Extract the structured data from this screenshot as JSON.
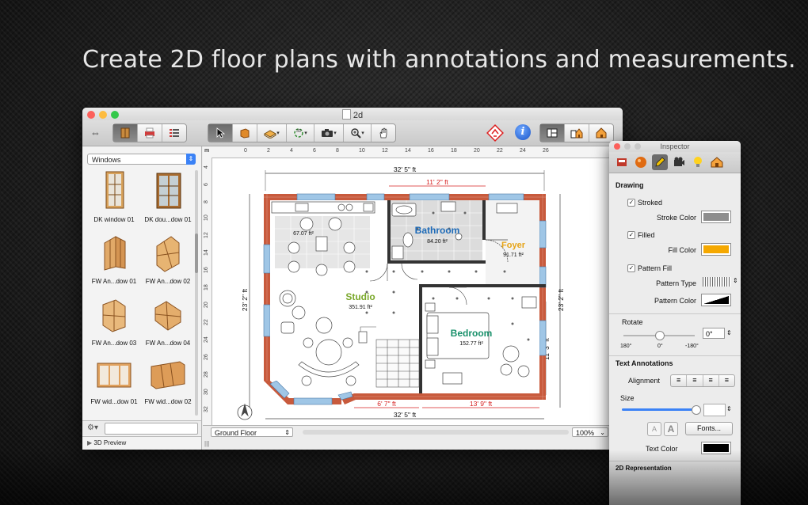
{
  "headline": "Create 2D floor plans with annotations and measurements.",
  "window": {
    "title": "2d",
    "traffic_lights": {
      "close": "#fc605b",
      "minimize": "#fdbc40",
      "zoom": "#34c84a"
    }
  },
  "toolbar": {
    "icons": [
      "resize-arrows-icon",
      "window-icon",
      "printer-icon",
      "list-icon",
      "pointer-icon",
      "wall-icon",
      "floor-icon",
      "rotate-icon",
      "camera-icon",
      "zoom-icon",
      "hand-icon",
      "warning-icon",
      "info-icon",
      "layout-2d-icon",
      "layout-split-icon",
      "layout-3d-icon"
    ]
  },
  "sidebar": {
    "category": "Windows",
    "items": [
      {
        "label": "DK window 01"
      },
      {
        "label": "DK dou...dow 01"
      },
      {
        "label": "FW An...dow 01"
      },
      {
        "label": "FW An...dow 02"
      },
      {
        "label": "FW An...dow 03"
      },
      {
        "label": "FW An...dow 04"
      },
      {
        "label": "FW wid...dow 01"
      },
      {
        "label": "FW wid...dow 02"
      }
    ],
    "preview_label": "3D Preview"
  },
  "ruler": {
    "unit": "m",
    "h_ticks": [
      "0",
      "2",
      "4",
      "6",
      "8",
      "10",
      "12",
      "14",
      "16",
      "18",
      "20",
      "22",
      "24",
      "26"
    ],
    "v_ticks": [
      "4",
      "6",
      "8",
      "10",
      "12",
      "14",
      "16",
      "18",
      "20",
      "22",
      "24",
      "26",
      "28",
      "30",
      "32"
    ]
  },
  "plan": {
    "dimensions": {
      "top_total": "32' 5\" ft",
      "top_bath": "11' 2\" ft",
      "left": "23' 2\" ft",
      "right": "23' 2\" ft",
      "right_bed": "11' 3\" ft",
      "bottom_left": "6' 7\" ft",
      "bottom_right": "13' 9\" ft",
      "bottom_total": "32' 5\" ft"
    },
    "rooms": {
      "kitchen_area": "67.07 ft²",
      "bathroom_name": "Bathroom",
      "bathroom_area": "84.20 ft²",
      "foyer_name": "Foyer",
      "foyer_area": "91.71 ft²",
      "studio_name": "Studio",
      "studio_area": "351.91 ft²",
      "bedroom_name": "Bedroom",
      "bedroom_area": "152.77 ft²"
    },
    "colors": {
      "bathroom": "#1e6bb8",
      "foyer": "#e6a417",
      "studio": "#7aa82b",
      "bedroom": "#18906a",
      "brick": "#c85a3c",
      "window": "#9fc6e6",
      "dim_red": "#d62020"
    }
  },
  "statusbar": {
    "floor": "Ground Floor",
    "zoom": "100%"
  },
  "inspector": {
    "title": "Inspector",
    "drawing_header": "Drawing",
    "stroked_label": "Stroked",
    "stroked": true,
    "stroke_color_label": "Stroke Color",
    "stroke_color": "#8e8e8e",
    "filled_label": "Filled",
    "filled": true,
    "fill_color_label": "Fill Color",
    "fill_color": "#f5a800",
    "pattern_fill_label": "Pattern Fill",
    "pattern_fill": true,
    "pattern_type_label": "Pattern Type",
    "pattern_color_label": "Pattern Color",
    "rotate_label": "Rotate",
    "rotate_value": "0°",
    "rotate_ticks": [
      "180°",
      "0°",
      "-180°"
    ],
    "text_annotations_header": "Text Annotations",
    "alignment_label": "Alignment",
    "size_label": "Size",
    "font_small": "A",
    "font_large": "A",
    "fonts_button": "Fonts...",
    "text_color_label": "Text Color",
    "text_color": "#000000",
    "representation_header": "2D Representation"
  }
}
